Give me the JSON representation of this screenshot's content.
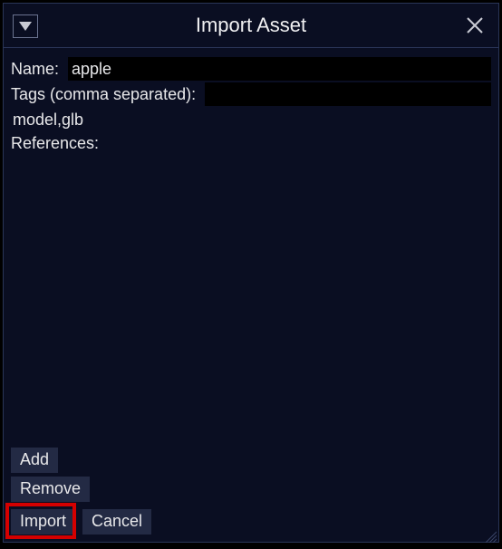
{
  "window": {
    "title": "Import Asset"
  },
  "form": {
    "name_label": "Name:",
    "name_value": "apple",
    "tags_label": "Tags (comma separated):",
    "tags_value": "model,glb",
    "references_label": "References:"
  },
  "buttons": {
    "add": "Add",
    "remove": "Remove",
    "import": "Import",
    "cancel": "Cancel"
  }
}
